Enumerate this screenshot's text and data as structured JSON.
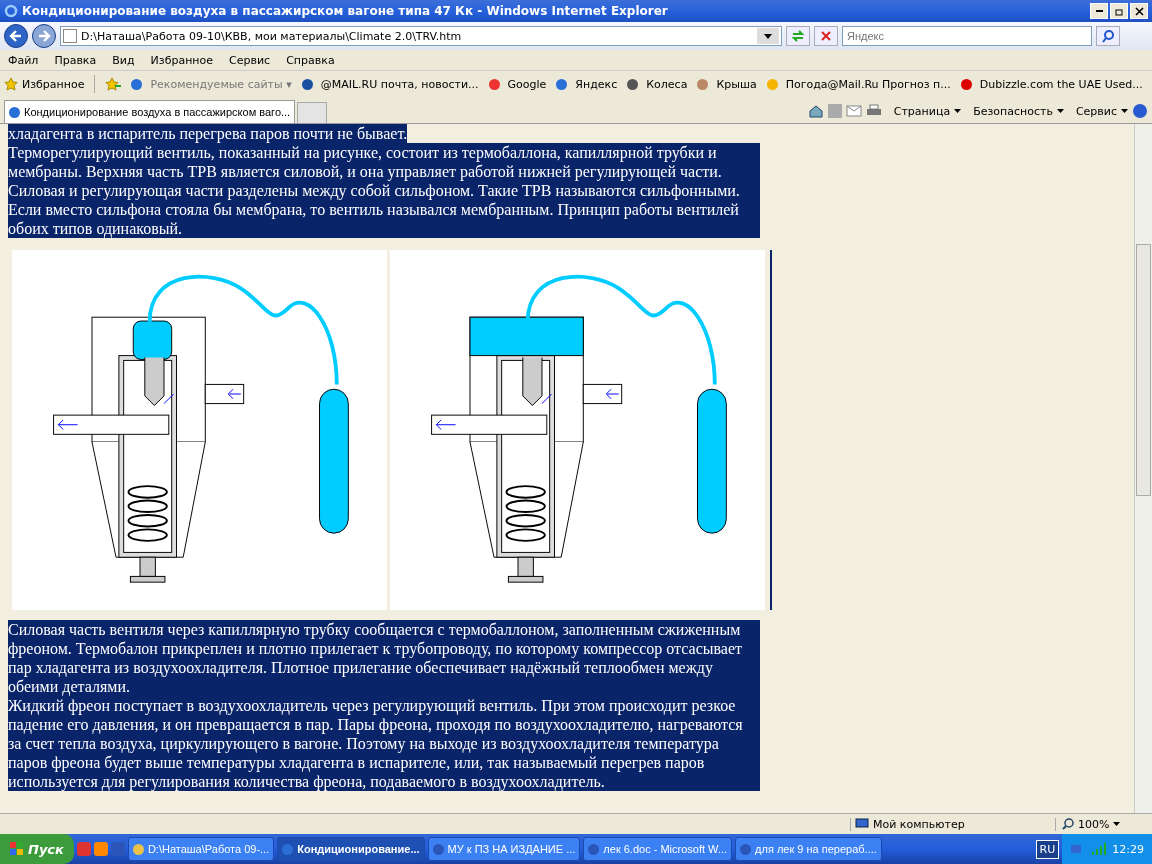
{
  "window": {
    "title": "Кондиционирование воздуха в пассажирском вагоне типа 47 Кк - Windows Internet Explorer"
  },
  "address_bar": {
    "value": "D:\\Наташа\\Работа 09-10\\КВВ, мои материалы\\Climate 2.0\\TRV.htm"
  },
  "search": {
    "placeholder": "Яндекс"
  },
  "menu": [
    "Файл",
    "Правка",
    "Вид",
    "Избранное",
    "Сервис",
    "Справка"
  ],
  "favorites_bar": {
    "label": "Избранное",
    "items": [
      {
        "label": "Рекомендуемые сайты ▾",
        "kind": "ie"
      },
      {
        "label": "@MAIL.RU почта, новости...",
        "kind": "at"
      },
      {
        "label": "Google",
        "kind": "google"
      },
      {
        "label": "Яндекс",
        "kind": "ie"
      },
      {
        "label": "Колеса",
        "kind": "wheel"
      },
      {
        "label": "Крыша",
        "kind": "house"
      },
      {
        "label": "Погода@Mail.Ru Прогноз п...",
        "kind": "sun"
      },
      {
        "label": "Dubizzle.com the UAE  Used...",
        "kind": "flame"
      }
    ]
  },
  "tab": {
    "label": "Кондиционирование воздуха в пассажирском ваго..."
  },
  "command_bar": [
    "Страница",
    "Безопасность",
    "Сервис"
  ],
  "content": {
    "paragraphs_top": [
      "хладагента в испаритель перегрева паров почти не бывает.",
      "Терморегулирующий вентиль, показанный на рисунке, состоит из термобаллона, капиллярной трубки и мембраны. Верхняя часть ТРВ является силовой, и она управляет работой нижней регулирующей части. Силовая и регулирующая части разделены между собой сильфоном. Такие ТРВ называются сильфонными. Если вместо сильфона стояла бы мембрана, то вентиль назывался мембранным. Принцип работы вентилей обоих типов одинаковый."
    ],
    "paragraphs_bottom": [
      "Силовая часть вентиля через капиллярную трубку сообщается с термобаллоном, заполненным сжиженным фреоном. Термобалон прикреплен и плотно прилегает к трубопроводу, по которому компрессор отсасывает пар хладагента из воздухоохладителя. Плотное прилегание обеспечивает надёжный теплообмен между обеими деталями.",
      "Жидкий фреон поступает в воздухоохладитель через регулирующий вентиль. При этом происходит резкое падение его давления, и он превращается в пар. Пары фреона, проходя по воздухоохладителю, нагреваются за счет тепла воздуха, циркулирующего в вагоне. Поэтому на выходе из воздухоохладителя температура паров фреона будет выше температуры хладагента в испарителе, или, так называемый перегрев паров используется для регулирования количества фреона, подаваемого в воздухоохладитель."
    ],
    "figures": [
      {
        "kind": "bellows"
      },
      {
        "kind": "membrane"
      }
    ]
  },
  "status_bar": {
    "zone": "Мой компьютер",
    "zoom": "100%"
  },
  "taskbar": {
    "start": "Пуск",
    "tasks": [
      {
        "label": "D:\\Наташа\\Работа 09-...",
        "kind": "folder",
        "selected": false
      },
      {
        "label": "Кондиционирование...",
        "kind": "ie",
        "selected": true
      },
      {
        "label": "МУ к ПЗ НА ИЗДАНИЕ  ...",
        "kind": "word",
        "selected": false
      },
      {
        "label": "лек 6.doc - Microsoft W...",
        "kind": "word",
        "selected": false
      },
      {
        "label": "для лек 9 на перераб....",
        "kind": "word",
        "selected": false
      }
    ],
    "language": "RU",
    "clock": "12:29"
  }
}
